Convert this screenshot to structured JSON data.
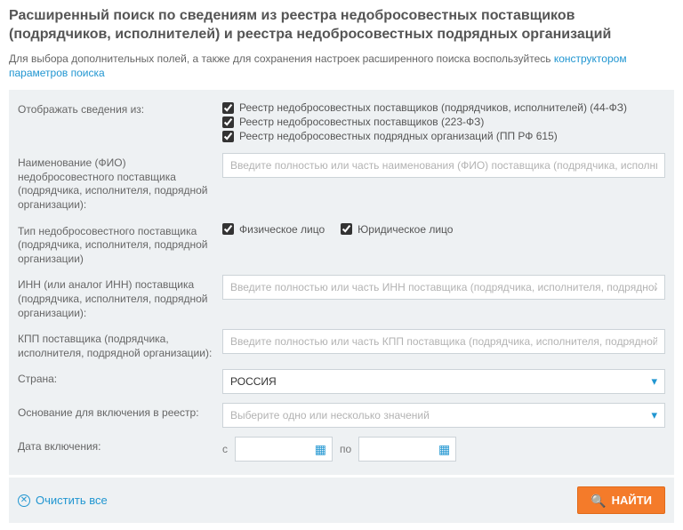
{
  "header": {
    "title": "Расширенный поиск по сведениям из реестра недобросовестных поставщиков (подрядчиков, исполнителей) и реестра недобросовестных подрядных организаций"
  },
  "note": {
    "prefix": "Для выбора дополнительных полей, а также для сохранения настроек расширенного поиска воспользуйтесь ",
    "link": "конструктором параметров поиска"
  },
  "labels": {
    "display_from": "Отображать сведения из:",
    "name": "Наименование (ФИО) недобросовестного поставщика (подрядчика, исполнителя, подрядной организации):",
    "supplier_type": "Тип недобросовестного поставщика (подрядчика, исполнителя, подрядной организации)",
    "inn": "ИНН (или аналог ИНН) поставщика (подрядчика, исполнителя, подрядной организации):",
    "kpp": "КПП поставщика (подрядчика, исполнителя, подрядной организации):",
    "country": "Страна:",
    "basis": "Основание для включения в реестр:",
    "date": "Дата включения:",
    "date_from": "с",
    "date_to": "по"
  },
  "display_from": [
    {
      "label": "Реестр недобросовестных поставщиков (подрядчиков, исполнителей) (44-ФЗ)",
      "checked": true
    },
    {
      "label": "Реестр недобросовестных поставщиков (223-ФЗ)",
      "checked": true
    },
    {
      "label": "Реестр недобросовестных подрядных организаций (ПП РФ 615)",
      "checked": true
    }
  ],
  "supplier_type": [
    {
      "label": "Физическое лицо",
      "checked": true
    },
    {
      "label": "Юридическое лицо",
      "checked": true
    }
  ],
  "placeholders": {
    "name": "Введите полностью или часть наименования (ФИО) поставщика (подрядчика, исполнителя, подрядной организации)",
    "inn": "Введите полностью или часть ИНН поставщика (подрядчика, исполнителя, подрядной организации)",
    "kpp": "Введите полностью или часть КПП поставщика (подрядчика, исполнителя, подрядной организации)",
    "basis": "Выберите одно или несколько значений"
  },
  "values": {
    "country": "РОССИЯ"
  },
  "footer": {
    "clear": "Очистить все",
    "search": "НАЙТИ"
  }
}
